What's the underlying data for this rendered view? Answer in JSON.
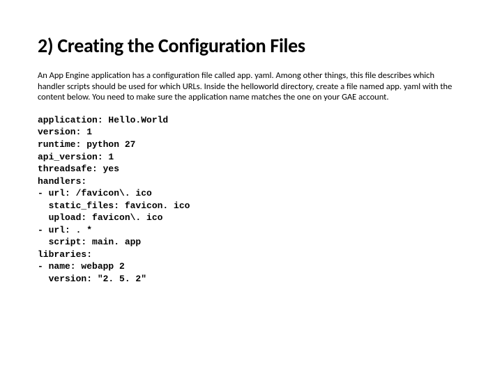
{
  "heading": "2) Creating the Configuration Files",
  "paragraph": "An App Engine application has a configuration file called app. yaml. Among other things, this file describes which handler scripts should be used for which URLs. Inside the helloworld directory, create a file named app. yaml with the content below. You need to make sure the application name matches the one on your GAE account.",
  "code": "application: Hello.World\nversion: 1\nruntime: python 27\napi_version: 1\nthreadsafe: yes\nhandlers:\n- url: /favicon\\. ico\n  static_files: favicon. ico\n  upload: favicon\\. ico\n- url: . *\n  script: main. app\nlibraries:\n- name: webapp 2\n  version: \"2. 5. 2\""
}
